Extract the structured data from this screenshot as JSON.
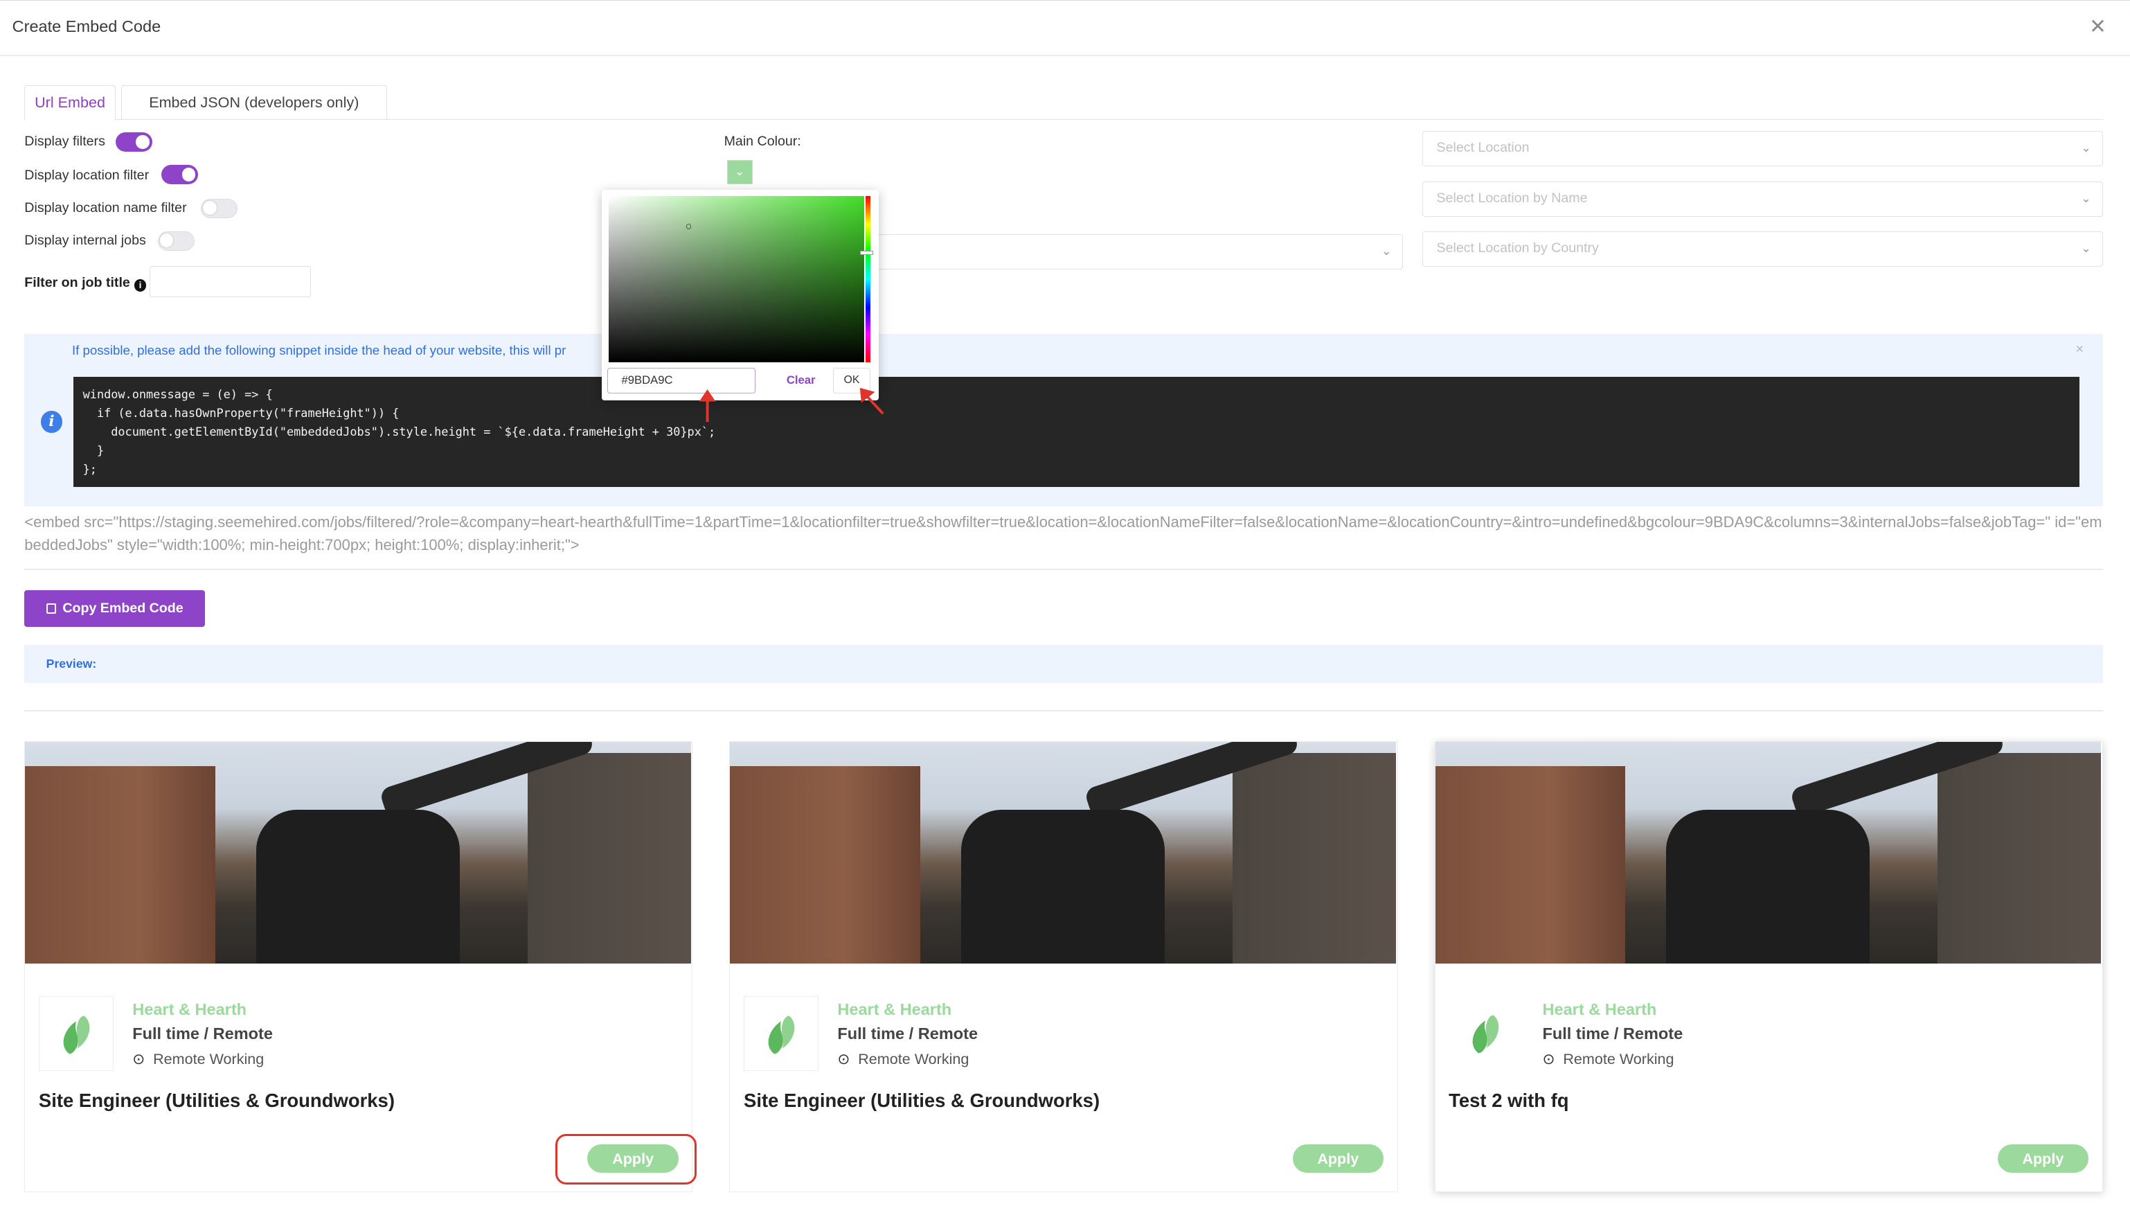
{
  "modal": {
    "title": "Create Embed Code",
    "close_glyph": "✕"
  },
  "tabs": [
    {
      "label": "Url Embed"
    },
    {
      "label": "Embed JSON (developers only)"
    }
  ],
  "options": [
    {
      "label": "Display filters",
      "on": true
    },
    {
      "label": "Display location filter",
      "on": true
    },
    {
      "label": "Display location name filter",
      "on": false
    },
    {
      "label": "Display internal jobs",
      "on": false
    }
  ],
  "job_title_filter": {
    "label": "Filter on job title",
    "info_glyph": "i",
    "value": ""
  },
  "main_colour": {
    "label": "Main Colour:",
    "value": "#9BDA9C",
    "chevron": "⌄"
  },
  "color_picker": {
    "hex_value": "#9BDA9C",
    "clear_label": "Clear",
    "ok_label": "OK"
  },
  "selects": {
    "location": "Select Location",
    "location_by_name": "Select Location by Name",
    "location_by_country": "Select Location by Country",
    "chevron": "⌄"
  },
  "snippet": {
    "notice": "If possible, please add the following snippet inside the head of your website, this will pr",
    "dismiss": "×",
    "info_glyph": "i",
    "code": "window.onmessage = (e) => {\n  if (e.data.hasOwnProperty(\"frameHeight\")) {\n    document.getElementById(\"embeddedJobs\").style.height = `${e.data.frameHeight + 30}px`;\n  }\n};"
  },
  "embed_code": "<embed src=\"https://staging.seemehired.com/jobs/filtered/?role=&company=heart-hearth&fullTime=1&partTime=1&locationfilter=true&showfilter=true&location=&locationNameFilter=false&locationName=&locationCountry=&intro=undefined&bgcolour=9BDA9C&columns=3&internalJobs=false&jobTag=\" id=\"embeddedJobs\" style=\"width:100%; min-height:700px; height:100%; display:inherit;\">",
  "copy_button": {
    "label": "Copy Embed Code"
  },
  "preview": {
    "label": "Preview:"
  },
  "brand": {
    "accent": "#8e44c8",
    "job_color": "#9BDA9C"
  },
  "jobs": [
    {
      "company": "Heart & Hearth",
      "type": "Full time / Remote",
      "location": "Remote Working",
      "title": "Site Engineer (Utilities & Groundworks)",
      "apply": "Apply"
    },
    {
      "company": "Heart & Hearth",
      "type": "Full time / Remote",
      "location": "Remote Working",
      "title": "Site Engineer (Utilities & Groundworks)",
      "apply": "Apply"
    },
    {
      "company": "Heart & Hearth",
      "type": "Full time / Remote",
      "location": "Remote Working",
      "title": "Test 2 with fq",
      "apply": "Apply"
    }
  ]
}
